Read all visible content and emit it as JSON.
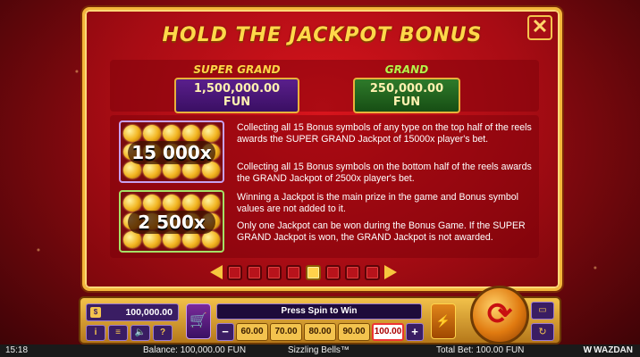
{
  "dialog": {
    "title": "HOLD THE JACKPOT BONUS",
    "close_label": "✕"
  },
  "jackpots": {
    "super_grand": {
      "name": "SUPER GRAND",
      "value": "1,500,000.00 FUN"
    },
    "grand": {
      "name": "GRAND",
      "value": "250,000.00 FUN"
    }
  },
  "rules": {
    "super_multiplier": "15 000x",
    "grand_multiplier": "2 500x",
    "paragraphs": [
      "Collecting all 15 Bonus symbols of any type on the top half of the reels awards the SUPER GRAND Jackpot of 15000x player's bet.",
      "Collecting all 15 Bonus symbols on the bottom half of the reels awards the GRAND Jackpot of 2500x player's bet.",
      "Winning a Jackpot is the main prize in the game and Bonus symbol values are not added to it.",
      "Only one Jackpot can be won during the Bonus Game. If the SUPER GRAND Jackpot is won, the GRAND Jackpot is not awarded."
    ]
  },
  "pagination": {
    "total_pages": 8,
    "current_page": 5
  },
  "controls": {
    "balance_icon": "wallet-icon",
    "balance": "100,000.00",
    "message": "Press Spin to Win",
    "bets": [
      "60.00",
      "70.00",
      "80.00",
      "90.00",
      "100.00"
    ],
    "selected_bet": "100.00",
    "minus_label": "−",
    "plus_label": "+",
    "small_buttons": [
      "i",
      "≡",
      "🔈",
      "?"
    ],
    "cart_label": "🛒",
    "speed_label": "⚡",
    "spin_label": "⟳",
    "auto_label": "▭",
    "auto2_label": "↻"
  },
  "status_bar": {
    "time": "15:18",
    "balance": "Balance: 100,000.00 FUN",
    "game": "Sizzling Bells™",
    "total_bet": "Total Bet: 100.00 FUN",
    "brand": "WAZDAN",
    "brand_mark": "W"
  },
  "colors": {
    "accent_gold": "#f3b63a",
    "panel_red": "#b80e16",
    "super_grand_purple": "#5a1f8c",
    "grand_green": "#2e7a2a",
    "active_dot": "#ffd34a"
  }
}
